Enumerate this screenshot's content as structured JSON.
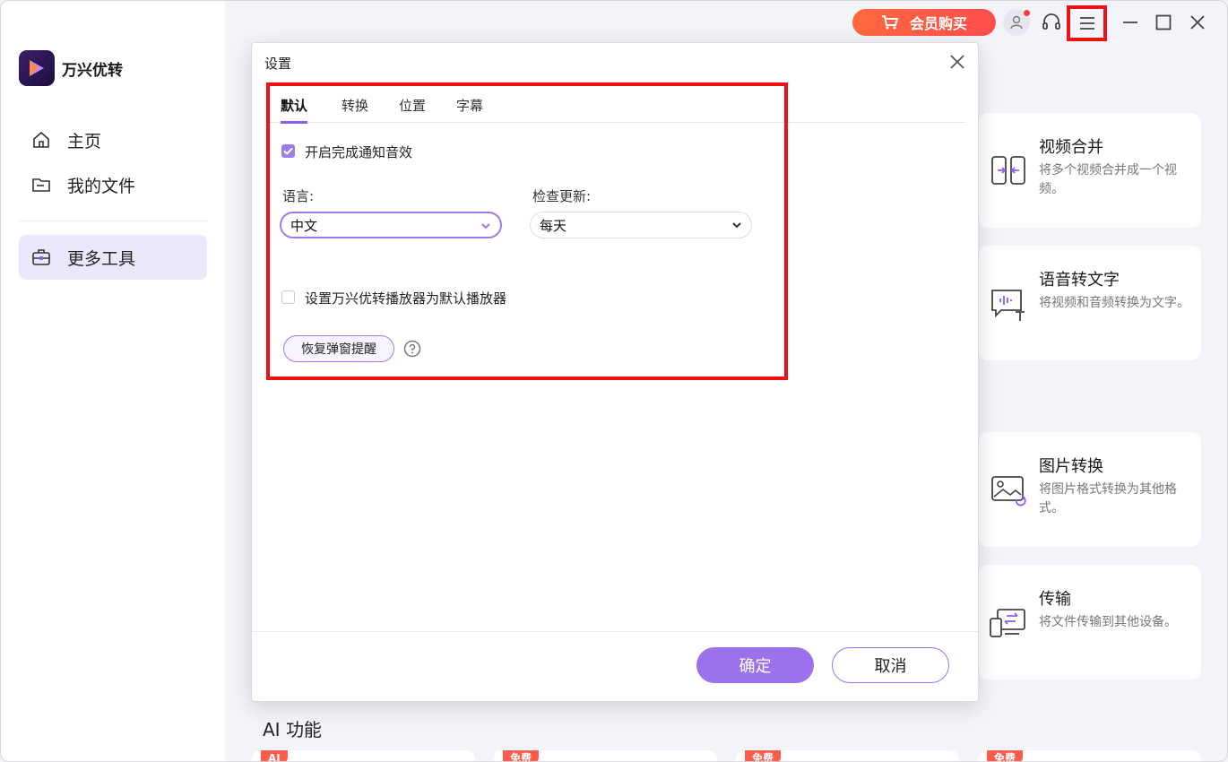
{
  "app": {
    "name": "万兴优转",
    "vip_button": "会员购买"
  },
  "sidebar": {
    "items": [
      {
        "label": "主页",
        "icon": "home-icon",
        "active": false
      },
      {
        "label": "我的文件",
        "icon": "folder-icon",
        "active": false
      },
      {
        "label": "更多工具",
        "icon": "toolbox-icon",
        "active": true
      }
    ]
  },
  "tools": [
    {
      "title": "视频合并",
      "desc": "将多个视频合并成一个视频。",
      "icon": "merge-icon"
    },
    {
      "title": "语音转文字",
      "desc": "将视频和音频转换为文字。",
      "icon": "speech-to-text-icon"
    },
    {
      "title": "图片转换",
      "desc": "将图片格式转换为其他格式。",
      "icon": "image-convert-icon"
    },
    {
      "title": "传输",
      "desc": "将文件传输到其他设备。",
      "icon": "transfer-icon"
    }
  ],
  "ai_section": {
    "title": "AI 功能",
    "badges": [
      "AI",
      "免费",
      "免费",
      "免费"
    ]
  },
  "dialog": {
    "title": "设置",
    "tabs": [
      "默认",
      "转换",
      "位置",
      "字幕"
    ],
    "active_tab": "默认",
    "notify_sound": {
      "label": "开启完成通知音效",
      "checked": true
    },
    "language": {
      "label": "语言:",
      "value": "中文"
    },
    "check_update": {
      "label": "检查更新:",
      "value": "每天"
    },
    "default_player": {
      "label": "设置万兴优转播放器为默认播放器",
      "checked": false
    },
    "restore_popup": "恢复弹窗提醒",
    "ok": "确定",
    "cancel": "取消"
  },
  "colors": {
    "accent": "#9b72ec",
    "highlight_box": "#ee1111",
    "vip": "#ff5a4a"
  }
}
